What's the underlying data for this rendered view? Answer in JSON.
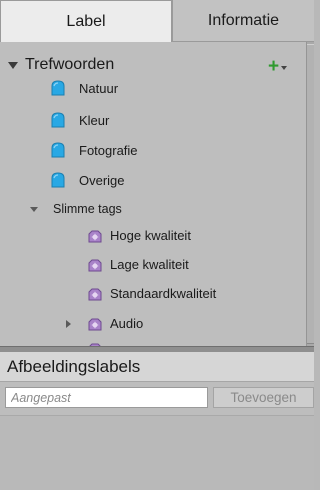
{
  "tabs": [
    {
      "label": "Label",
      "active": true
    },
    {
      "label": "Informatie",
      "active": false
    }
  ],
  "keywords": {
    "category": "Trefwoorden",
    "items": [
      {
        "label": "Natuur"
      },
      {
        "label": "Kleur"
      },
      {
        "label": "Fotografie"
      },
      {
        "label": "Overige"
      }
    ],
    "smart_tags": {
      "label": "Slimme tags",
      "items": [
        {
          "label": "Hoge kwaliteit"
        },
        {
          "label": "Lage kwaliteit"
        },
        {
          "label": "Standaardkwaliteit"
        },
        {
          "label": "Audio"
        }
      ]
    }
  },
  "image_labels": {
    "title": "Afbeeldingslabels",
    "input_placeholder": "Aangepast",
    "add_label": "Toevoegen"
  },
  "colors": {
    "keyword_icon": "#29a8e4",
    "smart_tag_icon": "#9a6fbf",
    "add_icon": "#2f9a2f"
  }
}
